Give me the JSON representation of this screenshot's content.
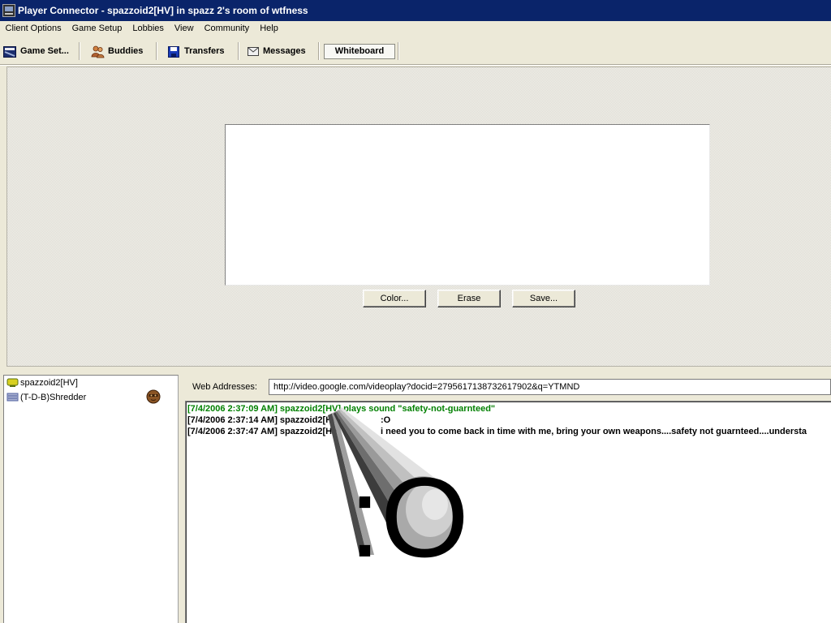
{
  "window": {
    "title": "Player Connector - spazzoid2[HV] in spazz 2's room of wtfness",
    "icon": "app-icon"
  },
  "menu": {
    "items": [
      "Client Options",
      "Game Setup",
      "Lobbies",
      "View",
      "Community",
      "Help"
    ]
  },
  "toolbar": {
    "items": [
      {
        "label": "Game Set...",
        "icon": "game-setup-icon"
      },
      {
        "label": "Buddies",
        "icon": "buddies-icon"
      },
      {
        "label": "Transfers",
        "icon": "floppy-disk-icon"
      },
      {
        "label": "Messages",
        "icon": "envelope-icon"
      },
      {
        "label": "Whiteboard",
        "selected": true
      }
    ]
  },
  "whiteboard": {
    "buttons": {
      "color": "Color...",
      "erase": "Erase",
      "save": "Save..."
    }
  },
  "users": [
    {
      "name": "spazzoid2[HV]",
      "icon": "user-status-icon"
    },
    {
      "name": "(T-D-B)Shredder",
      "icon": "user-status-icon",
      "avatar": "avatar-icon"
    }
  ],
  "web_addresses": {
    "label": "Web Addresses:",
    "value": "http://video.google.com/videoplay?docid=2795617138732617902&q=YTMND"
  },
  "chat": {
    "lines": [
      {
        "time": "[7/4/2006 2:37:09 AM]",
        "name": "spazzoid2[HV]",
        "text": "plays sound \"safety-not-guarnteed\"",
        "kind": "action"
      },
      {
        "time": "[7/4/2006 2:37:14 AM]",
        "name": "spazzoid2[HV]",
        "text": ":O",
        "kind": "message"
      },
      {
        "time": "[7/4/2006 2:37:47 AM]",
        "name": "spazzoid2[HV]",
        "text": "i need you to come back in time with me, bring your own weapons....safety not guarnteed....understa",
        "kind": "message"
      }
    ],
    "emote_overlay": ":O"
  },
  "colors": {
    "title_bar": "#0a246a",
    "title_text": "#ffffff",
    "panel": "#ece9d8",
    "chat_action": "#008000",
    "chat_text": "#000000"
  }
}
